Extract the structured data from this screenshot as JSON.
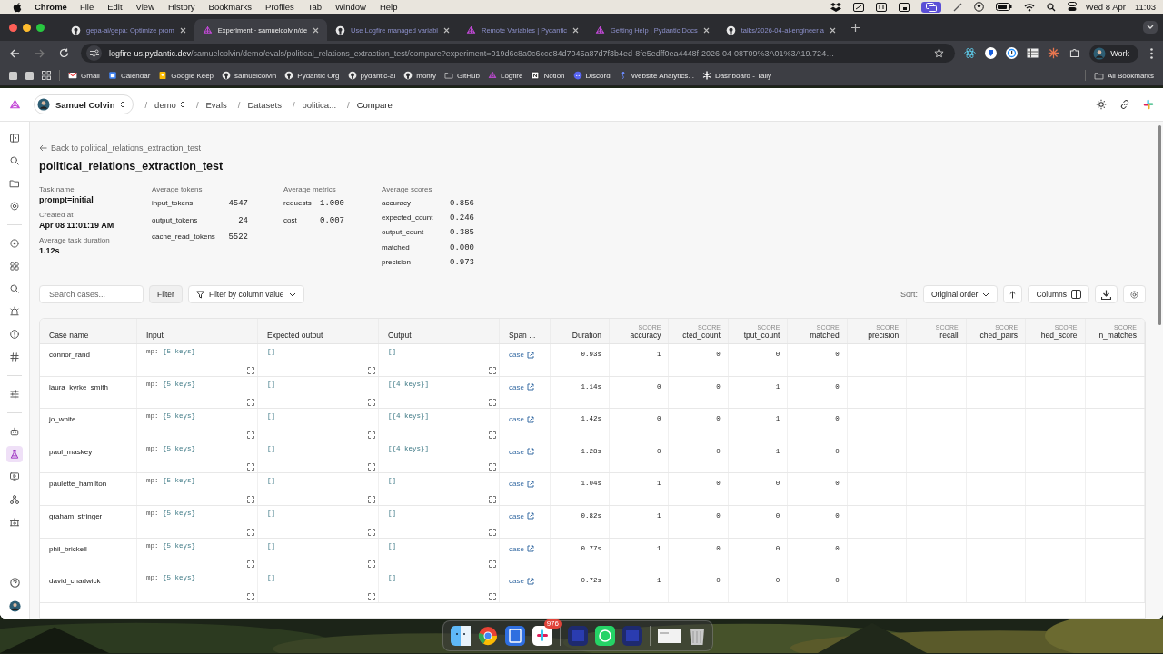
{
  "menubar": {
    "app": "Chrome",
    "menus": [
      "File",
      "Edit",
      "View",
      "History",
      "Bookmarks",
      "Profiles",
      "Tab",
      "Window",
      "Help"
    ],
    "date": "Wed 8 Apr",
    "time": "11:03"
  },
  "browser": {
    "tabs": [
      {
        "title": "gepa-ai/gepa: Optimize prom",
        "kind": "github",
        "selected": false
      },
      {
        "title": "Experiment · samuelcolvin/de",
        "kind": "logfire",
        "selected": true
      },
      {
        "title": "Use Logfire managed variabl",
        "kind": "github",
        "selected": false
      },
      {
        "title": "Remote Variables | Pydantic",
        "kind": "logfire",
        "selected": false
      },
      {
        "title": "Getting Help | Pydantic Docs",
        "kind": "logfire",
        "selected": false
      },
      {
        "title": "talks/2026-04-ai-engineer a",
        "kind": "github",
        "selected": false
      }
    ],
    "url_host": "logfire-us.pydantic.dev",
    "url_path": "/samuelcolvin/demo/evals/political_relations_extraction_test/compare?experiment=019d6c8a0c6cce84d7045a87d7f3b4ed-8fe5edff0ea4448f-2026-04-08T09%3A01%3A19.724…",
    "profile": "Work",
    "bookmarks": [
      {
        "label": "Gmail",
        "kind": "gmail"
      },
      {
        "label": "Calendar",
        "kind": "calendar"
      },
      {
        "label": "Google Keep",
        "kind": "keep"
      },
      {
        "label": "samuelcolvin",
        "kind": "github"
      },
      {
        "label": "Pydantic Org",
        "kind": "github"
      },
      {
        "label": "pydantic-ai",
        "kind": "github"
      },
      {
        "label": "monty",
        "kind": "github"
      },
      {
        "label": "GitHub",
        "kind": "folder"
      },
      {
        "label": "Logfire",
        "kind": "logfire"
      },
      {
        "label": "Notion",
        "kind": "notion"
      },
      {
        "label": "Discord",
        "kind": "discord"
      },
      {
        "label": "Website Analytics...",
        "kind": "analytics"
      },
      {
        "label": "Dashboard - Tally",
        "kind": "tally"
      }
    ],
    "all_bookmarks": "All Bookmarks"
  },
  "app": {
    "user": "Samuel Colvin",
    "breadcrumbs": [
      {
        "separator": "/",
        "label": "demo",
        "dropdown": true
      },
      {
        "separator": "/",
        "label": "Evals",
        "dropdown": false
      },
      {
        "separator": "/",
        "label": "Datasets",
        "dropdown": false
      },
      {
        "separator": "/",
        "label": "politica...",
        "dropdown": false
      },
      {
        "separator": "/",
        "label": "Compare",
        "dropdown": false
      }
    ]
  },
  "sidebar": {
    "sections": [
      {
        "items": [
          {
            "kind": "panel",
            "selected": false
          },
          {
            "kind": "search",
            "selected": false
          },
          {
            "kind": "folder",
            "selected": false
          },
          {
            "kind": "gear",
            "selected": false
          }
        ]
      },
      {
        "items": [
          {
            "kind": "target",
            "selected": false
          },
          {
            "kind": "grid",
            "selected": false
          },
          {
            "kind": "search",
            "selected": false
          },
          {
            "kind": "siren",
            "selected": false
          },
          {
            "kind": "alert",
            "selected": false
          },
          {
            "kind": "hash",
            "selected": false
          }
        ]
      },
      {
        "items": [
          {
            "kind": "sliders",
            "selected": false
          }
        ]
      },
      {
        "items": [
          {
            "kind": "robot",
            "selected": false
          },
          {
            "kind": "flask",
            "selected": true
          },
          {
            "kind": "monitor",
            "selected": false
          },
          {
            "kind": "network",
            "selected": false
          },
          {
            "kind": "bridge",
            "selected": false
          }
        ]
      }
    ],
    "footer": [
      {
        "kind": "help",
        "selected": false
      },
      {
        "kind": "avatar",
        "selected": false
      }
    ]
  },
  "page": {
    "back": "Back to political_relations_extraction_test",
    "title": "political_relations_extraction_test",
    "details": [
      {
        "label": "Task name",
        "value": "prompt=initial"
      },
      {
        "label": "Created at",
        "value": "Apr 08 11:01:19 AM"
      },
      {
        "label": "Average task duration",
        "value": "1.12s"
      }
    ],
    "groups": [
      {
        "title": "Average tokens",
        "items": [
          {
            "name": "input_tokens",
            "value": "4547"
          },
          {
            "name": "output_tokens",
            "value": "24"
          },
          {
            "name": "cache_read_tokens",
            "value": "5522"
          }
        ]
      },
      {
        "title": "Average metrics",
        "items": [
          {
            "name": "requests",
            "value": "1.000"
          },
          {
            "name": "cost",
            "value": "0.007"
          }
        ]
      },
      {
        "title": "Average scores",
        "items": [
          {
            "name": "accuracy",
            "value": "0.856"
          },
          {
            "name": "expected_count",
            "value": "0.246"
          },
          {
            "name": "output_count",
            "value": "0.385"
          },
          {
            "name": "matched",
            "value": "0.000"
          },
          {
            "name": "precision",
            "value": "0.973"
          }
        ]
      }
    ]
  },
  "toolbar": {
    "search_placeholder": "Search cases...",
    "filter": "Filter",
    "column_filter": "Filter by column value",
    "sort_label": "Sort:",
    "sort_value": "Original order",
    "columns": "Columns"
  },
  "table": {
    "columns": [
      {
        "label": "Case name",
        "kind": "plain"
      },
      {
        "label": "Input",
        "kind": "plain"
      },
      {
        "label": "Expected output",
        "kind": "plain"
      },
      {
        "label": "Output",
        "kind": "plain"
      },
      {
        "label": "Span ...",
        "kind": "plain"
      },
      {
        "label": "Duration",
        "kind": "number"
      },
      {
        "label": "accuracy",
        "kind": "score",
        "tag": "SCORE"
      },
      {
        "label": "cted_count",
        "kind": "score",
        "tag": "SCORE"
      },
      {
        "label": "tput_count",
        "kind": "score",
        "tag": "SCORE"
      },
      {
        "label": "matched",
        "kind": "score",
        "tag": "SCORE"
      },
      {
        "label": "precision",
        "kind": "score",
        "tag": "SCORE"
      },
      {
        "label": "recall",
        "kind": "score",
        "tag": "SCORE"
      },
      {
        "label": "ched_pairs",
        "kind": "score",
        "tag": "SCORE"
      },
      {
        "label": "hed_score",
        "kind": "score",
        "tag": "SCORE"
      },
      {
        "label": "n_matches",
        "kind": "score",
        "tag": "SCORE"
      }
    ],
    "rows": [
      {
        "name": "connor_rand",
        "input_type": "mp:",
        "input": "{5 keys}",
        "expected": "[]",
        "output": "[]",
        "span": "case",
        "duration": "0.93s",
        "scores": [
          "1",
          "0",
          "0",
          "0"
        ]
      },
      {
        "name": "laura_kyrke_smith",
        "input_type": "mp:",
        "input": "{5 keys}",
        "expected": "[]",
        "output": "[{4 keys}]",
        "span": "case",
        "duration": "1.14s",
        "scores": [
          "0",
          "0",
          "1",
          "0"
        ]
      },
      {
        "name": "jo_white",
        "input_type": "mp:",
        "input": "{5 keys}",
        "expected": "[]",
        "output": "[{4 keys}]",
        "span": "case",
        "duration": "1.42s",
        "scores": [
          "0",
          "0",
          "1",
          "0"
        ]
      },
      {
        "name": "paul_maskey",
        "input_type": "mp:",
        "input": "{5 keys}",
        "expected": "[]",
        "output": "[{4 keys}]",
        "span": "case",
        "duration": "1.28s",
        "scores": [
          "0",
          "0",
          "1",
          "0"
        ]
      },
      {
        "name": "paulette_hamilton",
        "input_type": "mp:",
        "input": "{5 keys}",
        "expected": "[]",
        "output": "[]",
        "span": "case",
        "duration": "1.04s",
        "scores": [
          "1",
          "0",
          "0",
          "0"
        ]
      },
      {
        "name": "graham_stringer",
        "input_type": "mp:",
        "input": "{5 keys}",
        "expected": "[]",
        "output": "[]",
        "span": "case",
        "duration": "0.82s",
        "scores": [
          "1",
          "0",
          "0",
          "0"
        ]
      },
      {
        "name": "phil_brickell",
        "input_type": "mp:",
        "input": "{5 keys}",
        "expected": "[]",
        "output": "[]",
        "span": "case",
        "duration": "0.77s",
        "scores": [
          "1",
          "0",
          "0",
          "0"
        ]
      },
      {
        "name": "david_chadwick",
        "input_type": "mp:",
        "input": "{5 keys}",
        "expected": "[]",
        "output": "[]",
        "span": "case",
        "duration": "0.72s",
        "scores": [
          "1",
          "0",
          "0",
          "0"
        ]
      }
    ]
  },
  "dock": {
    "badge": "976"
  }
}
